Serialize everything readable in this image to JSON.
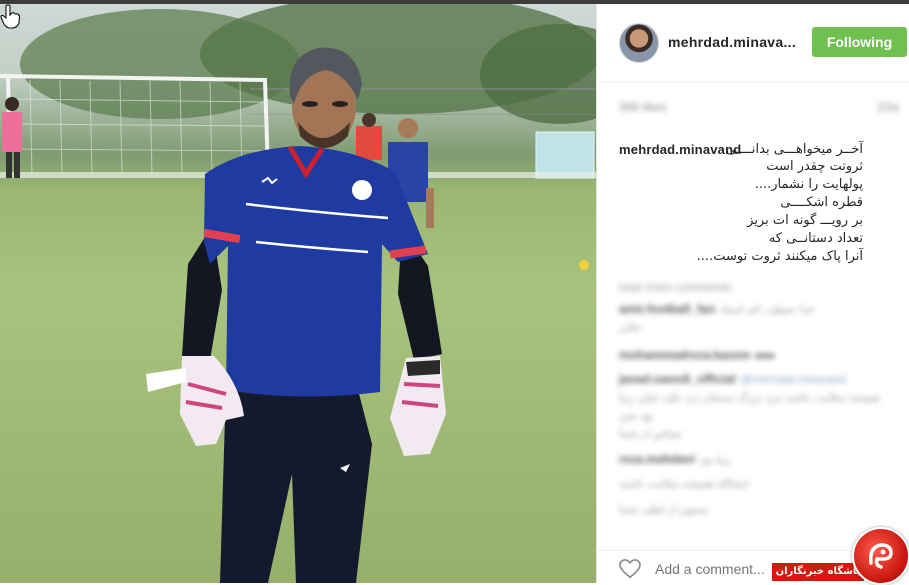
{
  "post": {
    "username": "mehrdad.minava...",
    "follow_label": "Following",
    "likes_text": "368 likes",
    "age_text": "22w",
    "caption_user": "mehrdad.minavand",
    "caption_lines": [
      "آخــر میخواهـــی بدانــــی",
      "ثروتت چقدر است",
      "پولهایت را نشمار....",
      "قطره اشکــــی",
      "بر رویـــ گونه ات بریز",
      "تعداد دستانــی که",
      "آنرا پاک میکنند ثروت توست...."
    ],
    "comments": [
      {
        "user": "load more comments",
        "text": ""
      },
      {
        "user": "amir.football_fan",
        "text": "خدا حفظت کنه استاد"
      },
      {
        "user": "",
        "text": "عالی"
      },
      {
        "user": "mohammadreza.kazem",
        "text": "●●●"
      },
      {
        "user": "javad.saeedi_official",
        "text": "@mehrdad.minavand"
      },
      {
        "user": "",
        "text": "همیشه سلامت باشید مرد بزرگ دستتان درد نکند خیلی زیبا بود متن"
      },
      {
        "user": "",
        "text": "سپاس از شما"
      },
      {
        "user": "reza.mahdavi",
        "text": "زیبا بود"
      },
      {
        "user": "",
        "text": "انشالله همیشه سلامت باشید"
      },
      {
        "user": "",
        "text": "ممنون از لطف شما"
      }
    ],
    "add_comment_placeholder": "Add a comment...",
    "more_label": "..."
  },
  "watermark": {
    "label": "باشگاه خبرنگاران"
  },
  "colors": {
    "follow_green": "#70c050",
    "text_dark": "#262626",
    "watermark_red": "#d21a10",
    "jersey_blue": "#1f3aa0"
  },
  "icons": [
    "hand-cursor-icon",
    "heart-icon",
    "more-options-icon",
    "watermark-logo-icon"
  ]
}
